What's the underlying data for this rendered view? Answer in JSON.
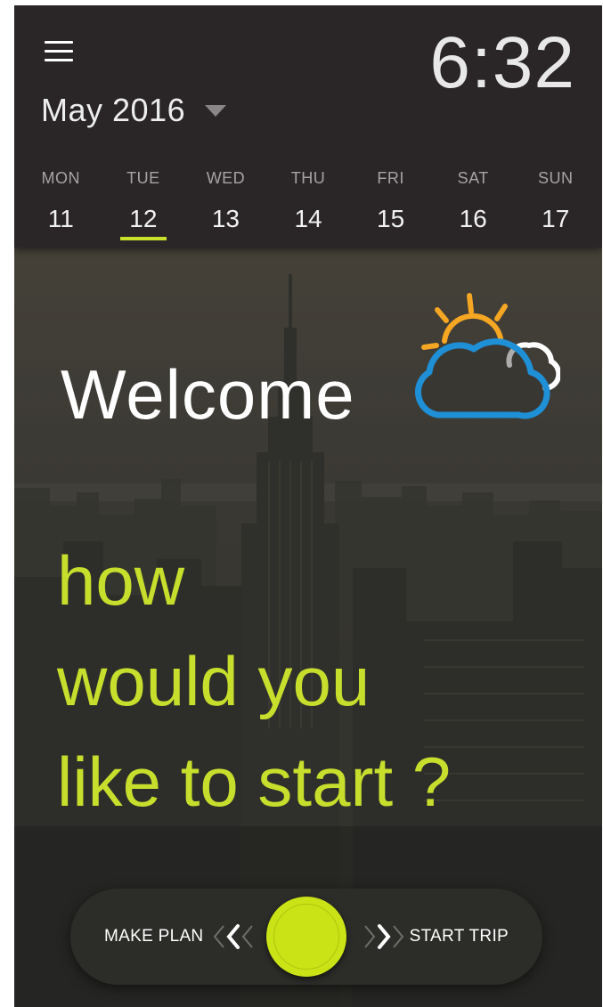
{
  "header": {
    "month": "May 2016",
    "time": "6:32"
  },
  "week": [
    {
      "day": "MON",
      "date": "11"
    },
    {
      "day": "TUE",
      "date": "12"
    },
    {
      "day": "WED",
      "date": "13"
    },
    {
      "day": "THU",
      "date": "14"
    },
    {
      "day": "FRI",
      "date": "15"
    },
    {
      "day": "SAT",
      "date": "16"
    },
    {
      "day": "SUN",
      "date": "17"
    }
  ],
  "hero": {
    "welcome": "Welcome",
    "prompt_lines": [
      "how",
      "would you",
      "like to start ?"
    ]
  },
  "slider": {
    "left_label": "MAKE PLAN",
    "right_label": "START TRIP"
  },
  "colors": {
    "accent": "#c9e12a",
    "cloud": "#1f8fd6",
    "sun": "#f5a623",
    "header_bg": "#2a2627"
  },
  "icons": {
    "menu": "hamburger-menu-icon",
    "month_dropdown": "caret-down-icon",
    "weather": "partly-cloudy-icon",
    "slide_left": "chevrons-left-icon",
    "slide_right": "chevrons-right-icon"
  }
}
